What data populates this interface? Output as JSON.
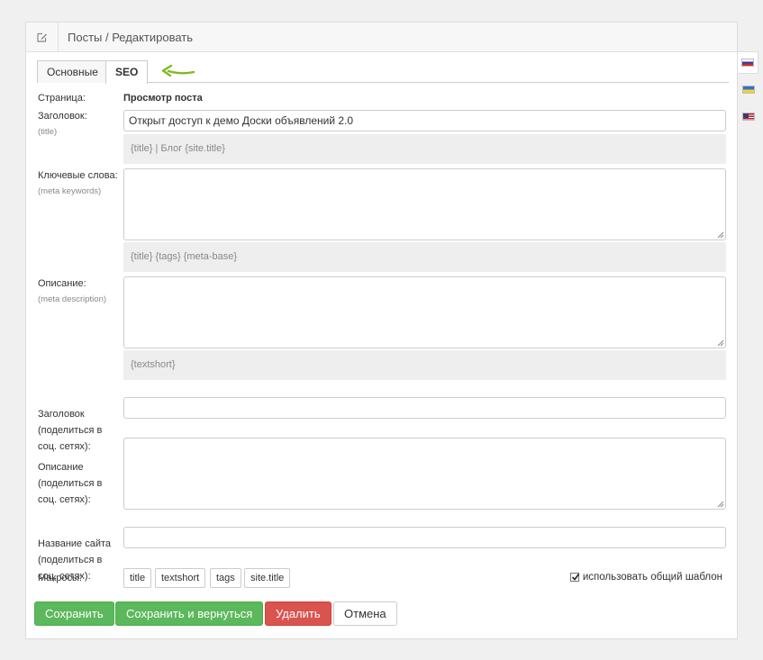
{
  "header": {
    "title": "Посты / Редактировать",
    "icon": "edit-icon"
  },
  "tabs": [
    {
      "label": "Основные",
      "active": false
    },
    {
      "label": "SEO",
      "active": true
    }
  ],
  "form": {
    "page": {
      "label": "Страница:",
      "value": "Просмотр поста"
    },
    "title": {
      "label": "Заголовок:",
      "sub": "(title)",
      "value": "Открыт доступ к демо Доски объявлений 2.0",
      "hint": "{title} | Блог {site.title}"
    },
    "keywords": {
      "label": "Ключевые слова:",
      "sub": "(meta keywords)",
      "value": "",
      "hint": "{title} {tags} {meta-base}"
    },
    "description": {
      "label": "Описание:",
      "sub": "(meta description)",
      "value": "",
      "hint": "{textshort}"
    },
    "share_title": {
      "label_lines": [
        "Заголовок",
        "(поделиться в",
        "соц. сетях):"
      ],
      "value": ""
    },
    "share_description": {
      "label_lines": [
        "Описание",
        "(поделиться в",
        "соц. сетях):"
      ],
      "value": ""
    },
    "site_name": {
      "label_lines": [
        "Название сайта",
        "(поделиться в",
        "соц. сетях):"
      ],
      "value": ""
    },
    "macros": {
      "label": "Макросы:",
      "items": [
        "title",
        "textshort",
        "tags",
        "site.title"
      ]
    },
    "use_common_template": {
      "label": "использовать общий шаблон",
      "checked": true
    }
  },
  "buttons": {
    "save": "Сохранить",
    "save_return": "Сохранить и вернуться",
    "delete": "Удалить",
    "cancel": "Отмена"
  },
  "languages": [
    {
      "name": "russian-flag-icon",
      "active": true,
      "colors": [
        "#ffffff",
        "#1a3fb5",
        "#d52b1e"
      ]
    },
    {
      "name": "ukrainian-flag-icon",
      "active": false,
      "colors": [
        "#2f6fd6",
        "#f4d22a"
      ]
    },
    {
      "name": "us-flag-icon",
      "active": false,
      "colors": [
        "#b22234",
        "#ffffff",
        "#3c3b6e"
      ]
    }
  ],
  "colors": {
    "success": "#5cb85c",
    "danger": "#d9534f",
    "annotation_arrow": "#7dbb1f"
  }
}
